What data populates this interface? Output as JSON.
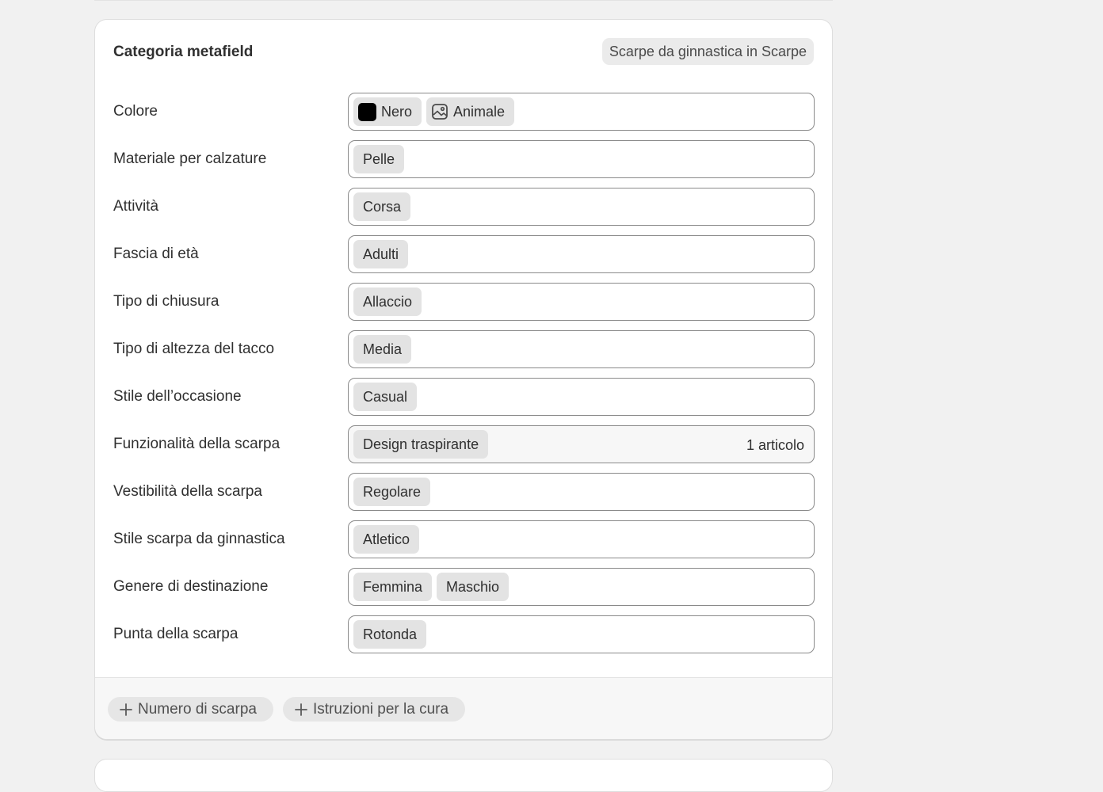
{
  "header": {
    "title": "Categoria metafield",
    "category_badge": "Scarpe da ginnastica in Scarpe"
  },
  "rows": [
    {
      "label": "Colore",
      "tags": [
        "Nero",
        "Animale"
      ]
    },
    {
      "label": "Materiale per calzature",
      "tags": [
        "Pelle"
      ]
    },
    {
      "label": "Attività",
      "tags": [
        "Corsa"
      ]
    },
    {
      "label": "Fascia di età",
      "tags": [
        "Adulti"
      ]
    },
    {
      "label": "Tipo di chiusura",
      "tags": [
        "Allaccio"
      ]
    },
    {
      "label": "Tipo di altezza del tacco",
      "tags": [
        "Media"
      ]
    },
    {
      "label": "Stile dell’occasione",
      "tags": [
        "Casual"
      ]
    },
    {
      "label": "Funzionalità della scarpa",
      "tags": [
        "Design traspirante"
      ],
      "count": "1 articolo"
    },
    {
      "label": "Vestibilità della scarpa",
      "tags": [
        "Regolare"
      ]
    },
    {
      "label": "Stile scarpa da ginnastica",
      "tags": [
        "Atletico"
      ]
    },
    {
      "label": "Genere di destinazione",
      "tags": [
        "Femmina",
        "Maschio"
      ]
    },
    {
      "label": "Punta della scarpa",
      "tags": [
        "Rotonda"
      ]
    }
  ],
  "swatch_color": "#000000",
  "footer": {
    "add_buttons": [
      "Numero di scarpa",
      "Istruzioni per la cura"
    ]
  }
}
